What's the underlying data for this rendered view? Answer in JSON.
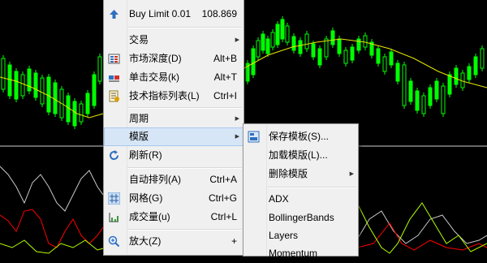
{
  "main_menu": {
    "items": [
      {
        "label": "Buy Limit 0.01",
        "shortcut": "108.869",
        "icon": "arrow-up-icon"
      },
      {
        "label": "交易",
        "arrow": "▶"
      },
      {
        "label": "市场深度(D)",
        "shortcut": "Alt+B",
        "icon": "market-depth-icon"
      },
      {
        "label": "单击交易(k)",
        "shortcut": "Alt+T",
        "icon": "one-click-trading-icon"
      },
      {
        "label": "技术指标列表(L)",
        "shortcut": "Ctrl+I",
        "icon": "indicator-list-icon"
      },
      {
        "label": "周期",
        "arrow": "▶"
      },
      {
        "label": "模版",
        "arrow": "▶"
      },
      {
        "label": "刷新(R)",
        "icon": "refresh-icon"
      },
      {
        "label": "自动排列(A)",
        "shortcut": "Ctrl+A"
      },
      {
        "label": "网格(G)",
        "shortcut": "Ctrl+G",
        "icon": "grid-icon"
      },
      {
        "label": "成交量(u)",
        "shortcut": "Ctrl+L",
        "icon": "volume-icon"
      },
      {
        "label": "放大(Z)",
        "shortcut": "+",
        "icon": "zoom-in-icon"
      }
    ]
  },
  "sub_menu": {
    "items": [
      {
        "label": "保存模板(S)...",
        "icon": "save-template-icon"
      },
      {
        "label": "加载模版(L)..."
      },
      {
        "label": "删除模版",
        "arrow": "▶"
      },
      {
        "label": "ADX"
      },
      {
        "label": "BollingerBands"
      },
      {
        "label": "Layers"
      },
      {
        "label": "Momentum"
      }
    ]
  },
  "colors": {
    "bull_candle": "#00ff00",
    "ma_line": "#e8e800",
    "indicator_line_1": "#ff0000",
    "indicator_line_2": "#c8c8c8",
    "indicator_line_3": "#b4ff00",
    "highlight": "#d6e6f7"
  }
}
